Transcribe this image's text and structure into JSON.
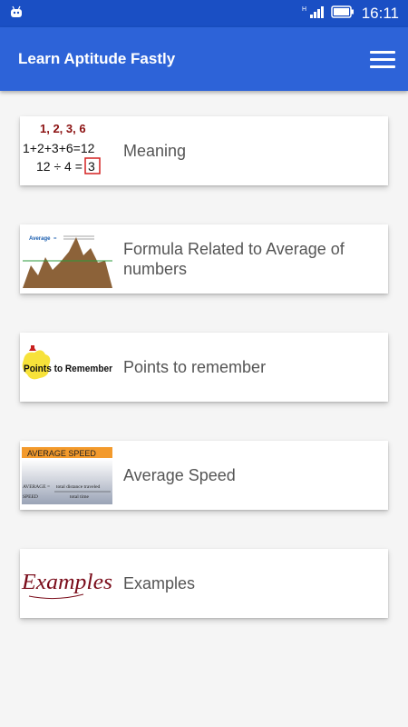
{
  "status_bar": {
    "time": "16:11",
    "icons": [
      "android-notification-icon",
      "signal-icon",
      "battery-icon"
    ]
  },
  "app_bar": {
    "title": "Learn Aptitude Fastly",
    "menu_icon": "hamburger-menu-icon"
  },
  "items": [
    {
      "label": "Meaning",
      "thumb": {
        "line1": "1, 2, 3, 6",
        "line2": "1+2+3+6=12",
        "line3": "12 ÷ 4 =",
        "answer": "3"
      }
    },
    {
      "label": "Formula Related to Average of numbers",
      "thumb": {
        "word": "Average",
        "eq": "="
      }
    },
    {
      "label": "Points to remember",
      "thumb": {
        "text": "Points to Remember"
      }
    },
    {
      "label": "Average Speed",
      "thumb": {
        "header": "AVERAGE SPEED",
        "left_top": "AVERAGE =",
        "right_top": "total distance traveled",
        "left_bottom": "SPEED",
        "right_bottom": "total time"
      }
    },
    {
      "label": "Examples",
      "thumb": {
        "text": "Examples"
      }
    }
  ],
  "colors": {
    "status_bar": "#1a4fc4",
    "app_bar": "#2d63d8",
    "background": "#f5f5f5"
  }
}
